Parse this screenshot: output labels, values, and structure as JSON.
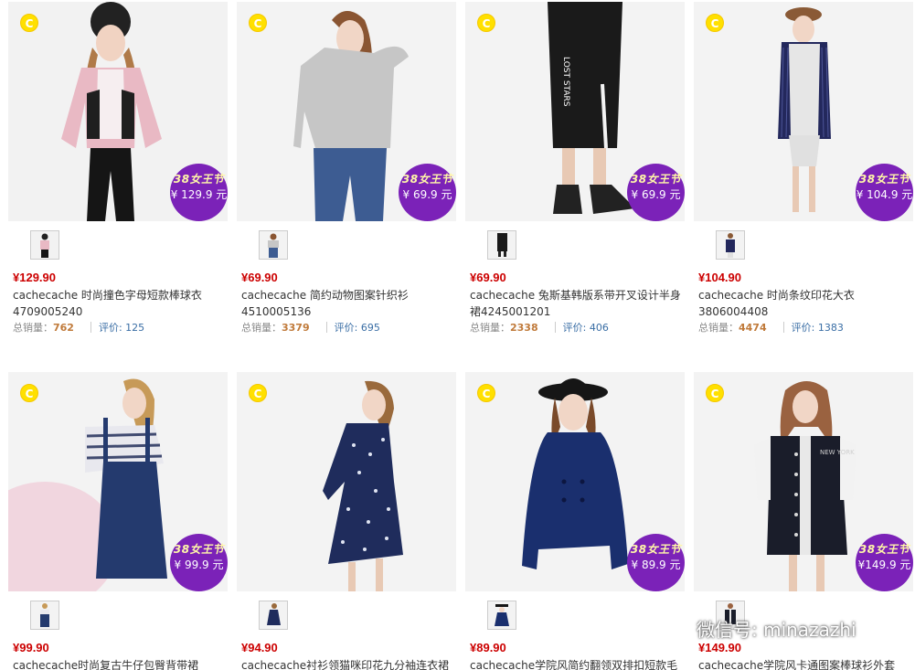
{
  "products": [
    {
      "promo": "38女王节",
      "badge_price": "¥ 129.9 元",
      "price": "¥129.90",
      "title": "cachecache 时尚撞色字母短款棒球衣4709005240",
      "sold_label": "总销量：",
      "sold": "762",
      "reviews_label": "评价: ",
      "reviews": "125"
    },
    {
      "promo": "38女王节",
      "badge_price": "¥ 69.9 元",
      "price": "¥69.90",
      "title": "cachecache 简约动物图案针织衫4510005136",
      "sold_label": "总销量：",
      "sold": "3379",
      "reviews_label": "评价: ",
      "reviews": "695"
    },
    {
      "promo": "38女王节",
      "badge_price": "¥ 69.9 元",
      "price": "¥69.90",
      "title": "cachecache 兔斯基韩版系带开叉设计半身裙4245001201",
      "sold_label": "总销量：",
      "sold": "2338",
      "reviews_label": "评价: ",
      "reviews": "406"
    },
    {
      "promo": "38女王节",
      "badge_price": "¥ 104.9 元",
      "price": "¥104.90",
      "title": "cachecache 时尚条纹印花大衣3806004408",
      "sold_label": "总销量：",
      "sold": "4474",
      "reviews_label": "评价: ",
      "reviews": "1383"
    },
    {
      "promo": "38女王节",
      "badge_price": "¥ 99.9 元",
      "price": "¥99.90",
      "title": "cachecache时尚复古牛仔包臀背带裙"
    },
    {
      "promo": "",
      "badge_price": "",
      "price": "¥94.90",
      "title": "cachecache衬衫领猫咪印花九分袖连衣裙"
    },
    {
      "promo": "38女王节",
      "badge_price": "¥ 89.9 元",
      "price": "¥89.90",
      "title": "cachecache学院风简约翻领双排扣短款毛"
    },
    {
      "promo": "38女王节",
      "badge_price": "¥149.9 元",
      "price": "¥149.90",
      "title": "cachecache学院风卡通图案棒球衫外套"
    }
  ],
  "badge_letter": "C",
  "watermark": "微信号: minazazhi",
  "colors": {
    "price": "#cc0000",
    "promo_badge": "#7b22b8",
    "c_badge": "#ffe000",
    "review_link": "#3a6ea5",
    "sold_count": "#c07a3a"
  }
}
